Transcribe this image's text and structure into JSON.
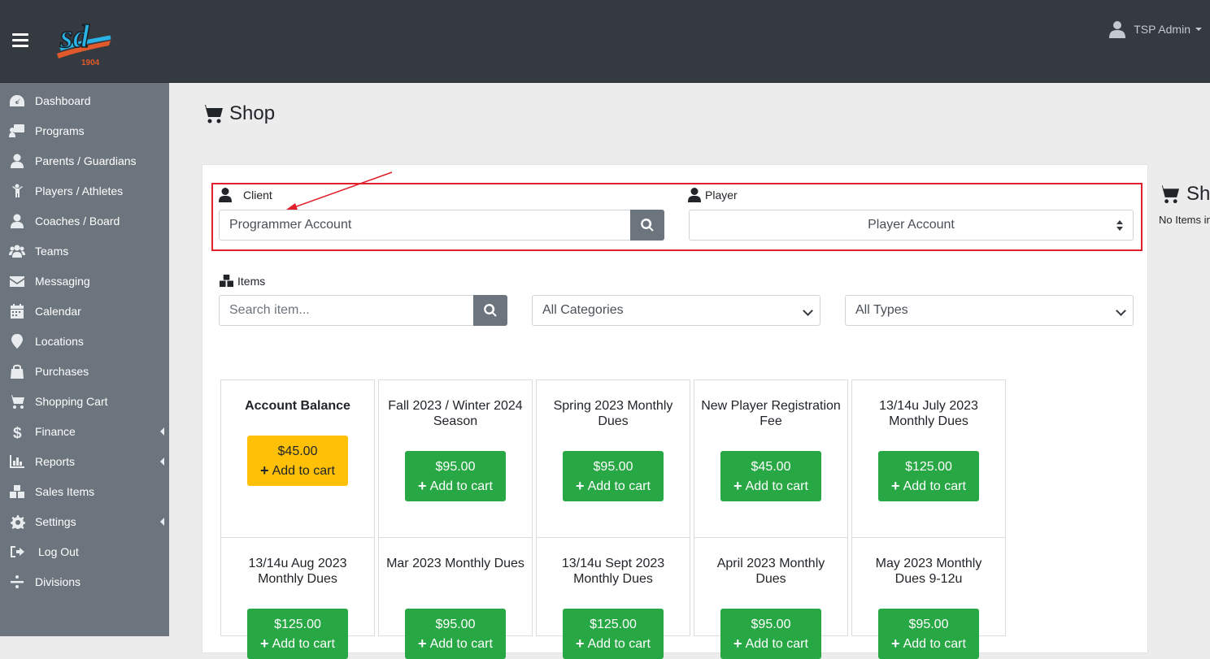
{
  "header": {
    "user_name": "TSP Admin",
    "logo_text": "sd",
    "logo_year": "1904"
  },
  "sidebar": {
    "items": [
      {
        "label": "Dashboard",
        "icon": "dashboard-icon"
      },
      {
        "label": "Programs",
        "icon": "programs-icon"
      },
      {
        "label": "Parents / Guardians",
        "icon": "user-icon"
      },
      {
        "label": "Players / Athletes",
        "icon": "child-icon"
      },
      {
        "label": "Coaches / Board",
        "icon": "user-tie-icon"
      },
      {
        "label": "Teams",
        "icon": "users-icon"
      },
      {
        "label": "Messaging",
        "icon": "envelope-icon"
      },
      {
        "label": "Calendar",
        "icon": "calendar-icon"
      },
      {
        "label": "Locations",
        "icon": "map-marker-icon"
      },
      {
        "label": "Purchases",
        "icon": "shopping-bag-icon"
      },
      {
        "label": "Shopping Cart",
        "icon": "cart-icon"
      },
      {
        "label": "Finance",
        "icon": "dollar-icon"
      },
      {
        "label": "Reports",
        "icon": "chart-bar-icon"
      },
      {
        "label": "Sales Items",
        "icon": "cubes-icon"
      },
      {
        "label": "Settings",
        "icon": "cog-icon"
      },
      {
        "label": "Log Out",
        "icon": "sign-out-icon"
      },
      {
        "label": "Divisions",
        "icon": "divide-icon"
      }
    ]
  },
  "page": {
    "title": "Shop"
  },
  "client": {
    "label": "Client",
    "value": "Programmer Account"
  },
  "player": {
    "label": "Player",
    "value": "Player Account"
  },
  "items": {
    "label": "Items",
    "search_placeholder": "Search item...",
    "category_value": "All Categories",
    "type_value": "All Types"
  },
  "cart_panel": {
    "title": "Shopping Cart",
    "empty": "No Items in cart"
  },
  "products": [
    {
      "name": "Account Balance",
      "price": "$45.00",
      "action": "Add to cart"
    },
    {
      "name": "Fall 2023 / Winter 2024 Season",
      "price": "$95.00",
      "action": "Add to cart"
    },
    {
      "name": "Spring 2023 Monthly Dues",
      "price": "$95.00",
      "action": "Add to cart"
    },
    {
      "name": "New Player Registration Fee",
      "price": "$45.00",
      "action": "Add to cart"
    },
    {
      "name": "13/14u July 2023 Monthly Dues",
      "price": "$125.00",
      "action": "Add to cart"
    },
    {
      "name": "13/14u Aug 2023 Monthly Dues",
      "price": "$125.00",
      "action": "Add to cart"
    },
    {
      "name": "Mar 2023 Monthly Dues",
      "price": "$95.00",
      "action": "Add to cart"
    },
    {
      "name": "13/14u Sept 2023 Monthly Dues",
      "price": "$125.00",
      "action": "Add to cart"
    },
    {
      "name": "April 2023 Monthly Dues",
      "price": "$95.00",
      "action": "Add to cart"
    },
    {
      "name": "May 2023 Monthly Dues 9-12u",
      "price": "$95.00",
      "action": "Add to cart"
    }
  ],
  "colors": {
    "header_bg": "#343a40",
    "sidebar_bg": "#6c757d",
    "success": "#28a745",
    "warning": "#ffc107",
    "highlight": "#e0202c"
  }
}
